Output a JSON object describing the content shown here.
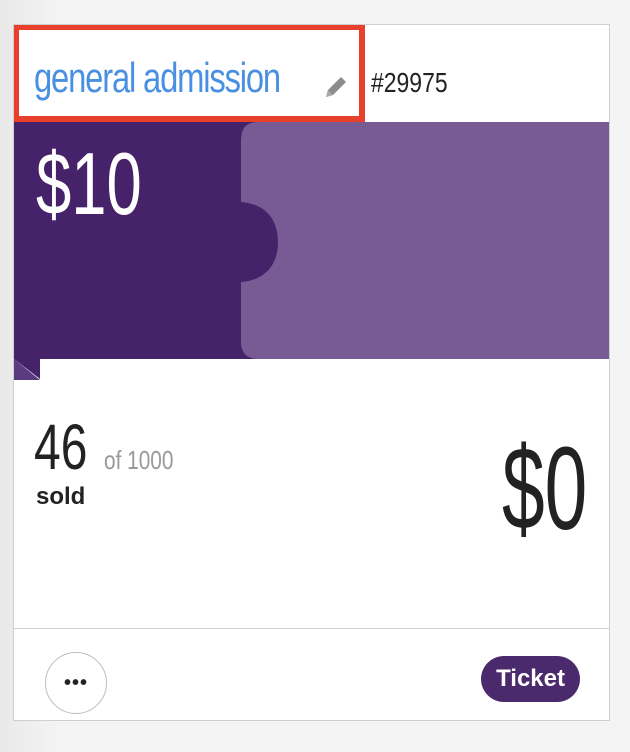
{
  "ticket": {
    "name": "general admission",
    "id": "#29975",
    "price": "$10",
    "sold": "46",
    "of_total": "of 1000",
    "sold_label": "sold",
    "revenue": "$0",
    "type_label": "Ticket"
  },
  "actions": {
    "more_label": "•••"
  },
  "colors": {
    "name_link": "#4a90e2",
    "highlight_border": "#e8402a",
    "banner_dark": "#45226a",
    "banner_light": "#785a95",
    "badge": "#4a2a6c"
  },
  "icons": {
    "edit": "pencil-icon",
    "more": "ellipsis-icon"
  }
}
